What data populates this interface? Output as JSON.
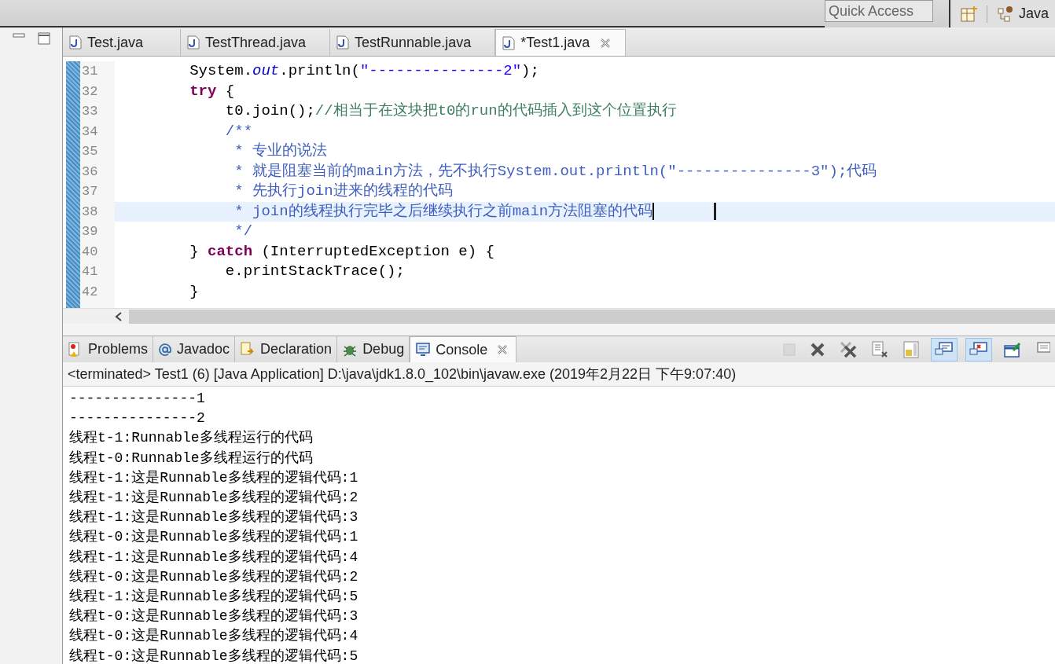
{
  "toolbar": {
    "quick_access": {
      "placeholder": "Quick Access"
    },
    "perspective": {
      "label": "Java",
      "selected": true
    }
  },
  "editor_tabs": [
    {
      "label": "Test.java",
      "selected": false
    },
    {
      "label": "TestThread.java",
      "selected": false
    },
    {
      "label": "TestRunnable.java",
      "selected": false
    },
    {
      "label": "*Test1.java",
      "selected": true
    }
  ],
  "editor": {
    "lines": [
      {
        "number": "31",
        "current": false,
        "tokens": [
          {
            "kind": "plain",
            "text": "        System."
          },
          {
            "kind": "field",
            "text": "out"
          },
          {
            "kind": "plain",
            "text": ".println("
          },
          {
            "kind": "string",
            "text": "\"---------------2\""
          },
          {
            "kind": "plain",
            "text": ");"
          }
        ]
      },
      {
        "number": "32",
        "current": false,
        "tokens": [
          {
            "kind": "keyword",
            "text": "        try"
          },
          {
            "kind": "plain",
            "text": " {"
          }
        ]
      },
      {
        "number": "33",
        "current": false,
        "tokens": [
          {
            "kind": "plain",
            "text": "            t0.join();"
          },
          {
            "kind": "comment",
            "text": "//相当于在这块把t0的run的代码插入到这个位置执行"
          }
        ]
      },
      {
        "number": "34",
        "current": false,
        "tokens": [
          {
            "kind": "javadoc",
            "text": "            /**"
          }
        ]
      },
      {
        "number": "35",
        "current": false,
        "tokens": [
          {
            "kind": "javadoc",
            "text": "             * 专业的说法"
          }
        ]
      },
      {
        "number": "36",
        "current": false,
        "tokens": [
          {
            "kind": "javadoc",
            "text": "             * 就是阻塞当前的main方法，先不执行System.out.println(\"---------------3\");代码"
          }
        ]
      },
      {
        "number": "37",
        "current": false,
        "tokens": [
          {
            "kind": "javadoc",
            "text": "             * 先执行join进来的线程的代码"
          }
        ]
      },
      {
        "number": "38",
        "current": true,
        "tokens": [
          {
            "kind": "javadoc",
            "text": "             * join的线程执行完毕之后继续执行之前main方法阻塞的代码"
          }
        ]
      },
      {
        "number": "39",
        "current": false,
        "tokens": [
          {
            "kind": "javadoc",
            "text": "             */"
          }
        ]
      },
      {
        "number": "40",
        "current": false,
        "tokens": [
          {
            "kind": "plain",
            "text": "        } "
          },
          {
            "kind": "keyword",
            "text": "catch"
          },
          {
            "kind": "plain",
            "text": " (InterruptedException e) {"
          }
        ]
      },
      {
        "number": "41",
        "current": false,
        "tokens": [
          {
            "kind": "plain",
            "text": "            e.printStackTrace();"
          }
        ]
      },
      {
        "number": "42",
        "current": false,
        "tokens": [
          {
            "kind": "plain",
            "text": "        }"
          }
        ]
      }
    ]
  },
  "view_tabs": [
    {
      "label": "Problems",
      "kind": "problems",
      "selected": false
    },
    {
      "label": "Javadoc",
      "kind": "javadoc",
      "selected": false
    },
    {
      "label": "Declaration",
      "kind": "declaration",
      "selected": false
    },
    {
      "label": "Debug",
      "kind": "debug",
      "selected": false
    },
    {
      "label": "Console",
      "kind": "console",
      "selected": true
    }
  ],
  "console_toolbar": [
    {
      "kind": "terminate",
      "disabled": true,
      "on": false
    },
    {
      "kind": "remove",
      "disabled": false,
      "on": false
    },
    {
      "kind": "remove-all",
      "disabled": false,
      "on": false
    },
    {
      "kind": "clear",
      "disabled": false,
      "on": false
    },
    {
      "kind": "scroll-lock",
      "disabled": false,
      "on": false
    },
    {
      "kind": "show-on-out",
      "disabled": false,
      "on": true
    },
    {
      "kind": "show-on-err",
      "disabled": false,
      "on": true
    },
    {
      "kind": "pin",
      "disabled": false,
      "on": false
    },
    {
      "kind": "display",
      "disabled": false,
      "on": false
    }
  ],
  "console": {
    "status": "<terminated> Test1 (6) [Java Application] D:\\java\\jdk1.8.0_102\\bin\\javaw.exe (2019年2月22日 下午9:07:40)",
    "output": [
      "---------------1",
      "---------------2",
      "线程t-1:Runnable多线程运行的代码",
      "线程t-0:Runnable多线程运行的代码",
      "线程t-1:这是Runnable多线程的逻辑代码:1",
      "线程t-1:这是Runnable多线程的逻辑代码:2",
      "线程t-1:这是Runnable多线程的逻辑代码:3",
      "线程t-0:这是Runnable多线程的逻辑代码:1",
      "线程t-1:这是Runnable多线程的逻辑代码:4",
      "线程t-0:这是Runnable多线程的逻辑代码:2",
      "线程t-1:这是Runnable多线程的逻辑代码:5",
      "线程t-0:这是Runnable多线程的逻辑代码:3",
      "线程t-0:这是Runnable多线程的逻辑代码:4",
      "线程t-0:这是Runnable多线程的逻辑代码:5"
    ]
  }
}
